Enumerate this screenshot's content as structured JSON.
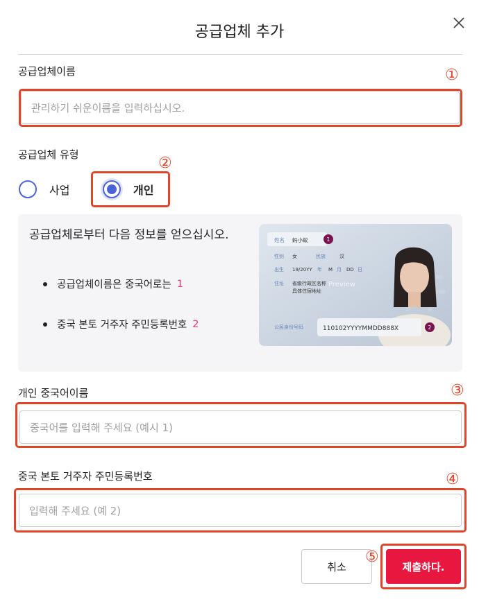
{
  "dialog": {
    "title": "공급업체 추가"
  },
  "fields": {
    "name": {
      "label": "공급업체이름",
      "placeholder": "관리하기 쉬운이름을 입력하십시오."
    },
    "type": {
      "label": "공급업체 유형",
      "options": [
        "사업",
        "개인"
      ],
      "selected": "개인"
    },
    "chinese_name": {
      "label": "개인 중국어이름",
      "placeholder": "중국어를 입력해 주세요 (예시 1)"
    },
    "id_number": {
      "label": "중국 본토 거주자 주민등록번호",
      "placeholder": "입력해 주세요 (예 2)"
    }
  },
  "info": {
    "heading": "공급업체로부터 다음 정보를 얻으십시오.",
    "items": [
      {
        "text": "공급업체이름은 중국어로는",
        "num": "1"
      },
      {
        "text": "중국 본토 거주자 주민등록번호",
        "num": "2"
      }
    ],
    "card": {
      "name_label": "姓名",
      "name_value": "蚂小蚁",
      "badge1": "1",
      "gender_label": "性别",
      "gender_value": "女",
      "ethnicity_label": "民族",
      "ethnicity_value": "汉",
      "birth_label": "出生",
      "birth_y": "19/20YY",
      "birth_y_unit": "年",
      "birth_m": "M",
      "birth_m_unit": "月",
      "birth_d": "DD",
      "birth_d_unit": "日",
      "addr_label": "住址",
      "addr_line1": "省级行政区名称",
      "addr_line2": "具体住宿地址",
      "id_label": "公民身份号码",
      "id_value": "110102YYYYMMDD888X",
      "badge2": "2",
      "watermark": "Preview"
    }
  },
  "buttons": {
    "cancel": "취소",
    "submit": "제출하다."
  },
  "annotations": [
    "①",
    "②",
    "③",
    "④",
    "⑤"
  ],
  "colors": {
    "accent": "#4a63d8",
    "submit": "#e8173f",
    "annotation": "#e0452a",
    "number_highlight": "#e0347a"
  }
}
